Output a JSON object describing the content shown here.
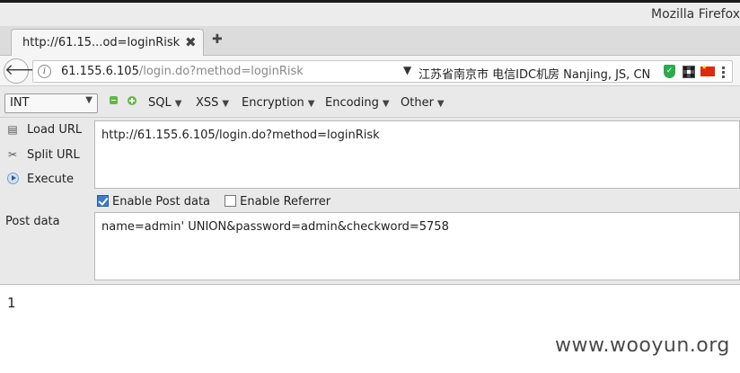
{
  "window": {
    "title": "Mozilla Firefox"
  },
  "tab": {
    "title": "http://61.15...od=loginRisk",
    "close_glyph": "✖",
    "new_tab_glyph": "✚"
  },
  "navbar": {
    "back_glyph": "🡐",
    "info_glyph": "i",
    "url_host": "61.155.6.105",
    "url_path": "/login.do?method=loginRisk",
    "dropdown_glyph": "▼",
    "ip_location": "江苏省南京市 电信IDC机房   Nanjing, JS, CN"
  },
  "hackbar": {
    "type_select": {
      "selected": "INT",
      "arrow": "▼"
    },
    "menus": [
      {
        "label": "SQL",
        "dd": "▼"
      },
      {
        "label": "XSS",
        "dd": "▼"
      },
      {
        "label": "Encryption",
        "dd": "▼"
      },
      {
        "label": "Encoding",
        "dd": "▼"
      },
      {
        "label": "Other",
        "dd": "▼"
      }
    ],
    "actions": {
      "load_url": "Load URL",
      "split_url": "Split URL",
      "execute": "Execute"
    },
    "url_value": "http://61.155.6.105/login.do?method=loginRisk",
    "enable_post": {
      "label": "Enable Post data",
      "checked": true
    },
    "enable_referrer": {
      "label": "Enable Referrer",
      "checked": false
    },
    "post_label": "Post data",
    "post_value": "name=admin' UNION&password=admin&checkword=5758"
  },
  "page": {
    "output": "1"
  },
  "watermark": "www.wooyun.org"
}
